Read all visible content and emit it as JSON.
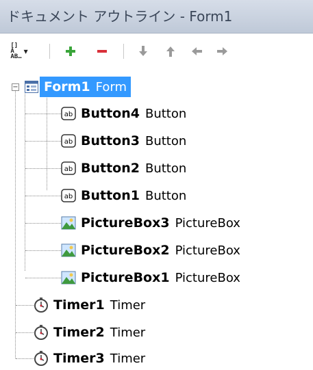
{
  "window": {
    "title": "ドキュメント アウトライン - Form1"
  },
  "toolbar": {
    "sort_glyph": "[]\nA\nAB…",
    "dropdown_glyph": "▾",
    "buttons": [
      {
        "id": "sort",
        "icon": "sort-icon"
      },
      {
        "id": "add",
        "icon": "plus-icon",
        "color": "#3aa53a"
      },
      {
        "id": "remove",
        "icon": "minus-icon",
        "color": "#d9303a"
      },
      {
        "id": "move-down",
        "icon": "arrow-down-icon",
        "color": "#9a9a9a"
      },
      {
        "id": "move-up",
        "icon": "arrow-up-icon",
        "color": "#9a9a9a"
      },
      {
        "id": "move-left",
        "icon": "arrow-left-icon",
        "color": "#9a9a9a"
      },
      {
        "id": "move-right",
        "icon": "arrow-right-icon",
        "color": "#9a9a9a"
      }
    ]
  },
  "tree": {
    "selected_color": "#3399ff",
    "root": {
      "name": "Form1",
      "type": "Form",
      "icon": "form-icon",
      "expanded": true,
      "expander_glyph": "−"
    },
    "children": [
      {
        "name": "Button4",
        "type": "Button",
        "icon": "button-icon"
      },
      {
        "name": "Button3",
        "type": "Button",
        "icon": "button-icon"
      },
      {
        "name": "Button2",
        "type": "Button",
        "icon": "button-icon"
      },
      {
        "name": "Button1",
        "type": "Button",
        "icon": "button-icon"
      },
      {
        "name": "PictureBox3",
        "type": "PictureBox",
        "icon": "picturebox-icon"
      },
      {
        "name": "PictureBox2",
        "type": "PictureBox",
        "icon": "picturebox-icon"
      },
      {
        "name": "PictureBox1",
        "type": "PictureBox",
        "icon": "picturebox-icon"
      }
    ],
    "components": [
      {
        "name": "Timer1",
        "type": "Timer",
        "icon": "timer-icon"
      },
      {
        "name": "Timer2",
        "type": "Timer",
        "icon": "timer-icon"
      },
      {
        "name": "Timer3",
        "type": "Timer",
        "icon": "timer-icon"
      }
    ]
  }
}
